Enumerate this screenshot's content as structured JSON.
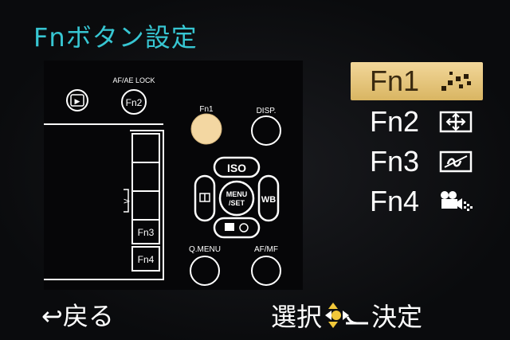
{
  "header": {
    "title": "Fnボタン設定"
  },
  "camera": {
    "af_ae_lock": "AF/AE LOCK",
    "play_symbol": "▶",
    "fn2": "Fn2",
    "fn1": "Fn1",
    "disp": "DISP.",
    "iso": "ISO",
    "wb": "WB",
    "menu_line1": "MENU",
    "menu_line2": "/SET",
    "q_menu": "Q.MENU",
    "af_mf": "AF/MF",
    "fn3": "Fn3",
    "fn4": "Fn4",
    "arrow": ">"
  },
  "fn_list": {
    "items": [
      {
        "label": "Fn1",
        "icon": "burst-icon",
        "selected": true
      },
      {
        "label": "Fn2",
        "icon": "af-area-icon",
        "selected": false
      },
      {
        "label": "Fn3",
        "icon": "ex-tele-conv-icon",
        "selected": false
      },
      {
        "label": "Fn4",
        "icon": "motion-picture-icon",
        "selected": false
      }
    ]
  },
  "footer": {
    "back_symbol": "↩",
    "back_label": "戻る",
    "select_label": "選択",
    "confirm_label": "決定"
  },
  "colors": {
    "title": "#37c6d2",
    "selected_bg": "#e9c77c",
    "fn1_button": "#f3d7a2"
  }
}
